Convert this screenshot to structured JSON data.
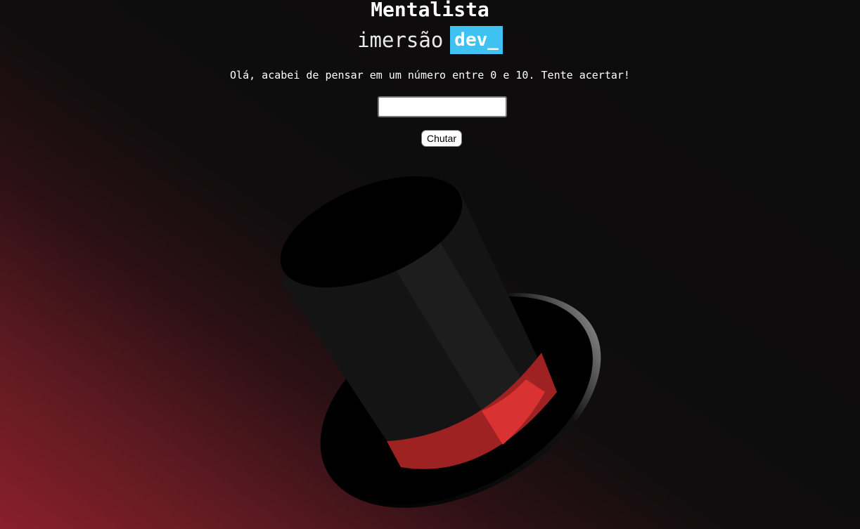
{
  "header": {
    "title": "Mentalista",
    "brand_word": "imersão",
    "brand_tag": "dev_"
  },
  "game": {
    "prompt": "Olá, acabei de pensar em um número entre 0 e 10. Tente acertar!",
    "input_value": "",
    "input_placeholder": "",
    "button_label": "Chutar"
  },
  "illustration": {
    "icon": "magician-top-hat-icon",
    "colors": {
      "hat": "#000000",
      "band": "#9e2222",
      "band_highlight": "#d83232"
    }
  },
  "theme": {
    "background": "#0c0c0c",
    "glow": "#8a1f2a",
    "accent": "#3fc1f1"
  }
}
